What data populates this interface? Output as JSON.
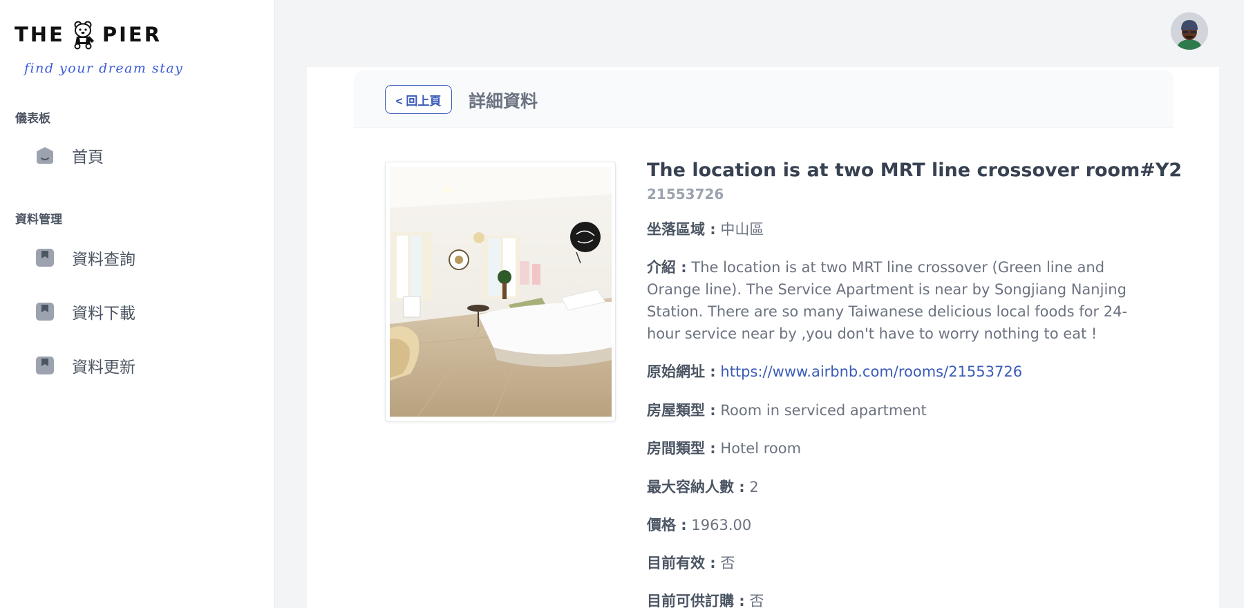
{
  "brand": {
    "logo_left": "THE",
    "logo_right": "PIER",
    "tagline": "find your dream stay"
  },
  "sidebar": {
    "sections": [
      {
        "title": "儀表板",
        "items": [
          {
            "label": "首頁",
            "icon": "home-icon"
          }
        ]
      },
      {
        "title": "資料管理",
        "items": [
          {
            "label": "資料查詢",
            "icon": "bookmark-icon"
          },
          {
            "label": "資料下載",
            "icon": "bookmark-icon"
          },
          {
            "label": "資料更新",
            "icon": "bookmark-icon"
          }
        ]
      }
    ]
  },
  "header": {
    "avatar_icon": "user-avatar-icon"
  },
  "page": {
    "back_label": "< 回上頁",
    "title": "詳細資料"
  },
  "listing": {
    "name": "The location is at two MRT line crossover room#Y2",
    "id": "21553726",
    "fields": [
      {
        "label": "坐落區域 :",
        "value": "中山區"
      },
      {
        "label": "介紹 :",
        "value": "The location is at two MRT line crossover (Green line and Orange line). The Service Apartment is near by Songjiang Nanjing Station. There are so many Taiwanese delicious local foods for 24-hour service near by ,you don't have to worry nothing to eat !"
      },
      {
        "label": "原始網址 :",
        "value": "https://www.airbnb.com/rooms/21553726"
      },
      {
        "label": "房屋類型 :",
        "value": "Room in serviced apartment"
      },
      {
        "label": "房間類型 :",
        "value": "Hotel room"
      },
      {
        "label": "最大容納人數 :",
        "value": "2"
      },
      {
        "label": "價格 :",
        "value": "1963.00"
      },
      {
        "label": "目前有效 :",
        "value": "否"
      },
      {
        "label": "目前可供訂購 :",
        "value": "否"
      }
    ]
  },
  "colors": {
    "accent": "#3b5bb8",
    "sidebar_bg": "#ffffff",
    "page_bg": "#f3f4f6"
  }
}
